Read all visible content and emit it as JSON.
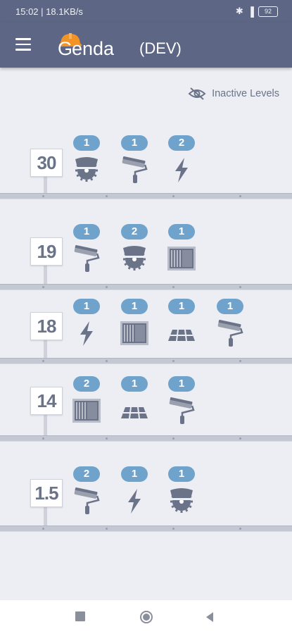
{
  "status": {
    "left": "15:02 | 18.1KB/s",
    "battery": "92"
  },
  "app": {
    "logo_g": "G",
    "logo_text": "enda",
    "env": "(DEV)"
  },
  "toggle": {
    "label": "Inactive Levels",
    "icon": "eye-off-icon"
  },
  "colors": {
    "appbar": "#5d6785",
    "badge": "#6fa3cc",
    "accent": "#f39325",
    "icon": "#6b7389"
  },
  "levels": [
    {
      "number": "30",
      "tasks": [
        {
          "icon": "saw-icon",
          "count": "1"
        },
        {
          "icon": "roller-icon",
          "count": "1"
        },
        {
          "icon": "lightning-icon",
          "count": "2"
        }
      ]
    },
    {
      "number": "19",
      "tasks": [
        {
          "icon": "roller-icon",
          "count": "1"
        },
        {
          "icon": "saw-icon",
          "count": "2"
        },
        {
          "icon": "drywall-icon",
          "count": "1"
        }
      ]
    },
    {
      "number": "18",
      "tasks": [
        {
          "icon": "lightning-icon",
          "count": "1"
        },
        {
          "icon": "drywall-icon",
          "count": "1"
        },
        {
          "icon": "tiles-icon",
          "count": "1"
        },
        {
          "icon": "roller-icon",
          "count": "1"
        }
      ]
    },
    {
      "number": "14",
      "tasks": [
        {
          "icon": "drywall-icon",
          "count": "2"
        },
        {
          "icon": "tiles-icon",
          "count": "1"
        },
        {
          "icon": "roller-icon",
          "count": "1"
        }
      ]
    },
    {
      "number": "1.5",
      "tasks": [
        {
          "icon": "roller-icon",
          "count": "2"
        },
        {
          "icon": "lightning-icon",
          "count": "1"
        },
        {
          "icon": "saw-icon",
          "count": "1"
        }
      ]
    }
  ],
  "nav": {
    "recents": "square-icon",
    "home": "circle-icon",
    "back": "triangle-back-icon"
  }
}
